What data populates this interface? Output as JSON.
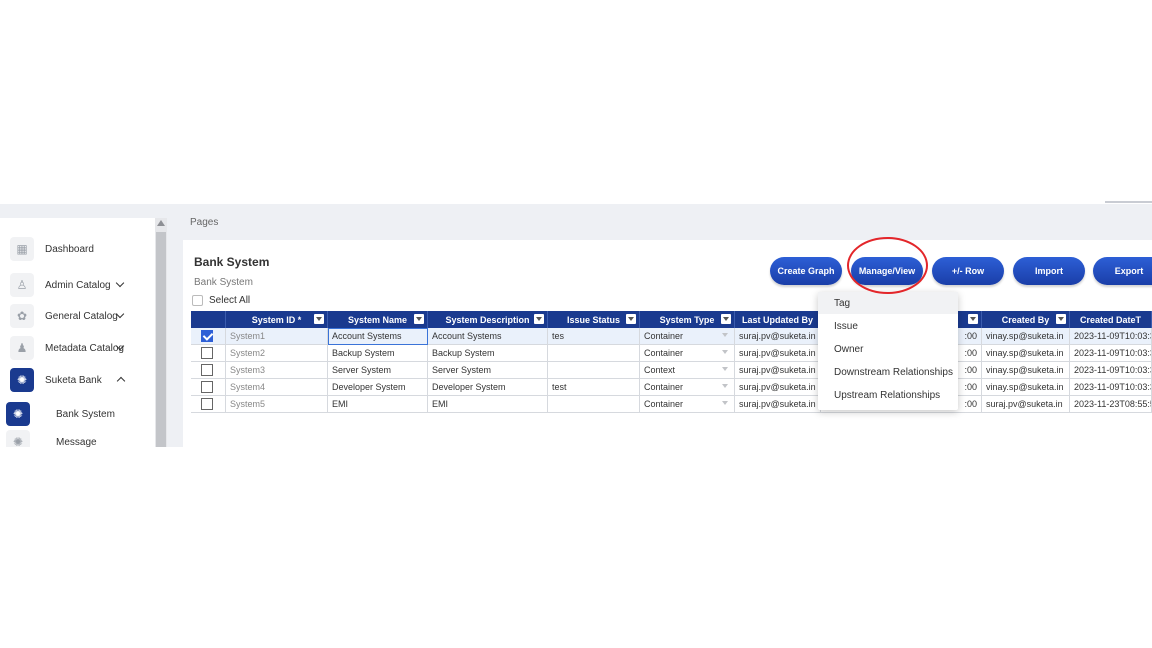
{
  "breadcrumb": "Pages",
  "sidebar": {
    "items": [
      {
        "label": "Dashboard",
        "icon": "dashboard-icon"
      },
      {
        "label": "Admin Catalog",
        "icon": "admin-icon"
      },
      {
        "label": "General Catalog",
        "icon": "catalog-icon"
      },
      {
        "label": "Metadata Catalog",
        "icon": "metadata-icon"
      },
      {
        "label": "Suketa Bank",
        "icon": "bank-icon"
      }
    ],
    "subitems": [
      {
        "label": "Bank System",
        "icon": "system-icon"
      },
      {
        "label": "Message",
        "icon": "message-icon"
      }
    ]
  },
  "page": {
    "title": "Bank System",
    "subtitle": "Bank System",
    "select_all": "Select All"
  },
  "toolbar": {
    "create_graph": "Create Graph",
    "manage_view": "Manage/View",
    "row": "+/- Row",
    "import": "Import",
    "export": "Export"
  },
  "menu": {
    "items": [
      "Tag",
      "Issue",
      "Owner",
      "Downstream Relationships",
      "Upstream Relationships"
    ]
  },
  "grid": {
    "headers": [
      "System ID *",
      "System Name",
      "System Description",
      "Issue Status",
      "System Type",
      "Last Updated By",
      "",
      "Created By",
      "Created DateT"
    ],
    "rows": [
      {
        "id": "System1",
        "name": "Account Systems",
        "desc": "Account Systems",
        "issue": "tes",
        "type": "Container",
        "updated_by": "suraj.pv@suketa.in",
        "time": ":00",
        "created_by": "vinay.sp@suketa.in",
        "created": "2023-11-09T10:03:3"
      },
      {
        "id": "System2",
        "name": "Backup System",
        "desc": "Backup System",
        "issue": "",
        "type": "Container",
        "updated_by": "suraj.pv@suketa.in",
        "time": ":00",
        "created_by": "vinay.sp@suketa.in",
        "created": "2023-11-09T10:03:3"
      },
      {
        "id": "System3",
        "name": "Server System",
        "desc": "Server System",
        "issue": "",
        "type": "Context",
        "updated_by": "suraj.pv@suketa.in",
        "time": ":00",
        "created_by": "vinay.sp@suketa.in",
        "created": "2023-11-09T10:03:3"
      },
      {
        "id": "System4",
        "name": "Developer System",
        "desc": "Developer System",
        "issue": "test",
        "type": "Container",
        "updated_by": "suraj.pv@suketa.in",
        "time": ":00",
        "created_by": "vinay.sp@suketa.in",
        "created": "2023-11-09T10:03:3"
      },
      {
        "id": "System5",
        "name": "EMI",
        "desc": "EMI",
        "issue": "",
        "type": "Container",
        "updated_by": "suraj.pv@suketa.in",
        "time": ":00",
        "created_by": "suraj.pv@suketa.in",
        "created": "2023-11-23T08:55:5"
      }
    ]
  },
  "colors": {
    "accent": "#1a3a8f",
    "button": "#2d5fd6",
    "highlight": "#e3262a"
  }
}
